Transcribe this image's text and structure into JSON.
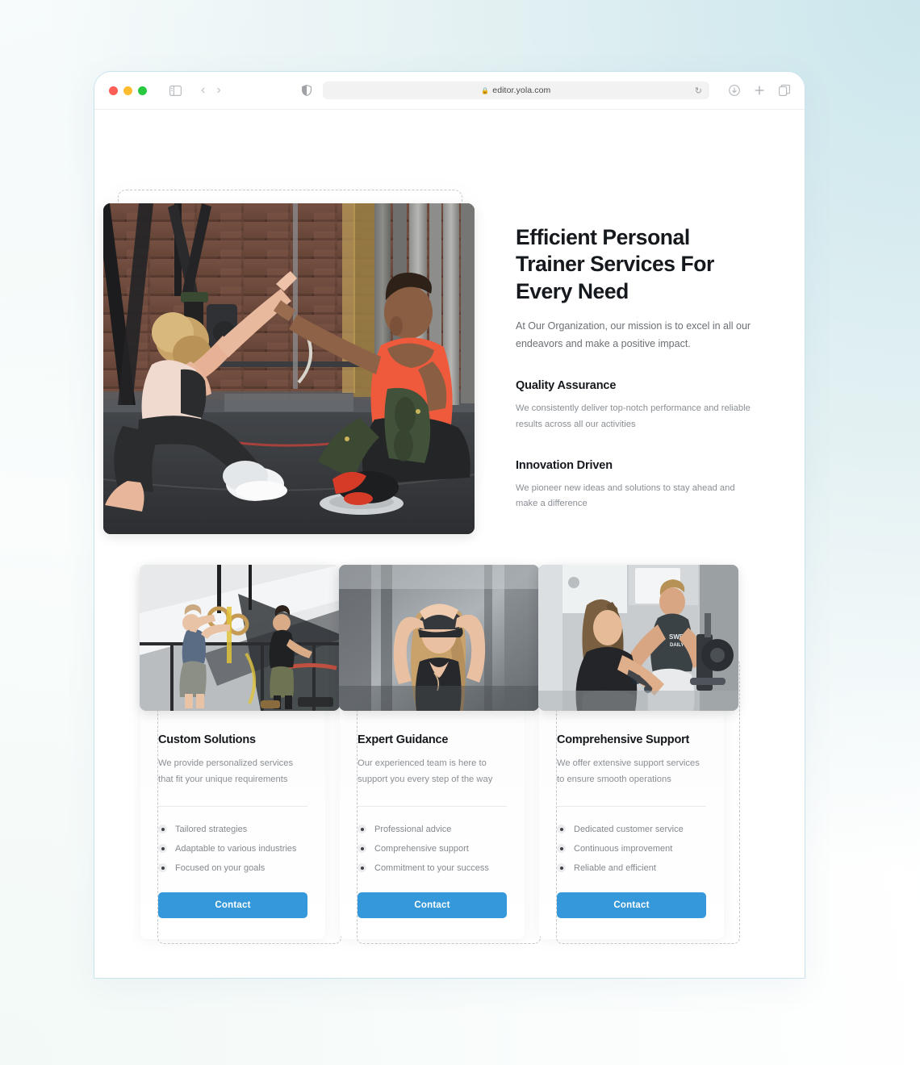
{
  "browser": {
    "traffic_lights": [
      "close",
      "minimize",
      "maximize"
    ],
    "sidebar_icon": "sidebar-toggle-icon",
    "back_label": "‹",
    "forward_label": "›",
    "shield_icon": "privacy-shield-icon",
    "lock_glyph": "🔒",
    "url": "editor.yola.com",
    "reload_glyph": "↻",
    "download_icon": "download-icon",
    "new_tab_glyph": "+",
    "tab_overview_icon": "tab-overview-icon"
  },
  "hero": {
    "image_alt": "two athletes high-fiving on gym floor",
    "heading": "Efficient Personal Trainer Services For Every Need",
    "lead": "At Our Organization, our mission is to excel in all our endeavors and make a positive impact.",
    "features": [
      {
        "title": "Quality Assurance",
        "text": "We consistently deliver top-notch performance and reliable results across all our activities"
      },
      {
        "title": "Innovation Driven",
        "text": "We pioneer new ideas and solutions to stay ahead and make a difference"
      }
    ]
  },
  "cards": [
    {
      "image_alt": "man on gymnastics rings with coach",
      "title": "Custom Solutions",
      "subtitle": "We provide personalized services that fit your unique requirements",
      "bullets": [
        "Tailored strategies",
        "Adaptable to various industries",
        "Focused on your goals"
      ],
      "button": "Contact"
    },
    {
      "image_alt": "woman adjusting cap in gym",
      "title": "Expert Guidance",
      "subtitle": "Our experienced team is here to support you every step of the way",
      "bullets": [
        "Professional advice",
        "Comprehensive support",
        "Commitment to your success"
      ],
      "button": "Contact"
    },
    {
      "image_alt": "trainer coaching woman on weight machine",
      "title": "Comprehensive Support",
      "subtitle": "We offer extensive support services to ensure smooth operations",
      "bullets": [
        "Dedicated customer service",
        "Continuous improvement",
        "Reliable and efficient"
      ],
      "button": "Contact"
    }
  ],
  "colors": {
    "accent": "#3498db",
    "heading": "#15181c",
    "body_text": "#8a8f94",
    "page_bg_top_right": "#cbe6ec",
    "selection_outline": "#c3c6ca"
  }
}
